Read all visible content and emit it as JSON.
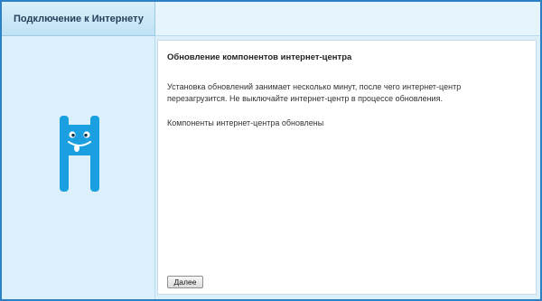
{
  "header": {
    "title": "Подключение к Интернету"
  },
  "sidebar": {
    "mascot_icon": "monster-mascot-icon",
    "mascot_color": "#1aa0e0"
  },
  "main": {
    "heading": "Обновление компонентов интернет-центра",
    "description": "Установка обновлений занимает несколько минут, после чего интернет-центр перезагрузится. Не выключайте интернет-центр в процессе обновления.",
    "status": "Компоненты интернет-центра обновлены",
    "next_button_label": "Далее"
  },
  "colors": {
    "frame_border": "#2c80c4",
    "panel_bg": "#dcf0fb"
  }
}
